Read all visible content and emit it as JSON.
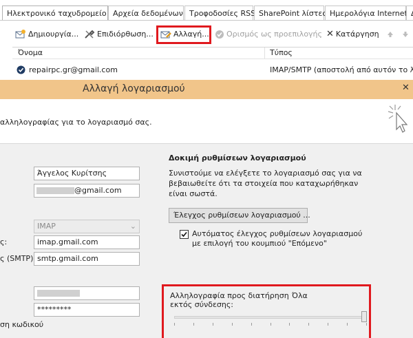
{
  "tabs": [
    {
      "label": "Ηλεκτρονικό ταχυδρομείο",
      "active": true
    },
    {
      "label": "Αρχεία δεδομένων"
    },
    {
      "label": "Τροφοδοσίες RSS"
    },
    {
      "label": "SharePoint λίστες"
    },
    {
      "label": "Ημερολόγια Internet"
    },
    {
      "label": "Δ"
    }
  ],
  "toolbar": {
    "new_label": "Δημιουργία...",
    "repair_label": "Επιδιόρθωση...",
    "change_label": "Αλλαγή...",
    "default_label": "Ορισμός ως προεπιλογής",
    "remove_label": "Κατάργηση"
  },
  "account_list": {
    "col_name": "Όνομα",
    "col_type": "Τύπος",
    "rows": [
      {
        "name": "repairpc.gr@gmail.com",
        "type": "IMAP/SMTP (αποστολή από αυτόν το λογ"
      }
    ]
  },
  "dialog": {
    "title": "Αλλαγή λογαριασμού",
    "close": "✕",
    "subtitle": "αλληλογραφίας για το λογαριασμό σας.",
    "fields": {
      "name_value": "Άγγελος Κυρίτσης",
      "email_suffix": "@gmail.com",
      "account_type": "IMAP",
      "incoming_label": "ς:",
      "incoming_value": "imap.gmail.com",
      "outgoing_label": "ς (SMTP):",
      "outgoing_value": "smtp.gmail.com",
      "password_value": "*********",
      "remember_label": "ση κωδικού"
    },
    "test": {
      "heading": "Δοκιμή ρυθμίσεων λογαριασμού",
      "description": "Συνιστούμε να ελέγξετε το λογαριασμό σας για να βεβαιωθείτε ότι τα στοιχεία που καταχωρήθηκαν είναι σωστά.",
      "button": "Έλεγχος ρυθμίσεων λογαριασμού ...",
      "auto_check_label": "Αυτόματος έλεγχος ρυθμίσεων λογαριασμού με επιλογή του κουμπιού \"Επόμενο\"",
      "auto_check_checked": true
    },
    "offline": {
      "label": "Αλληλογραφία προς διατήρηση εκτός σύνδεσης:",
      "value": "Όλα",
      "slider_fraction": 1.0
    }
  },
  "colors": {
    "highlight_red": "#e0191e",
    "title_bar": "#f1c58a",
    "body_bg": "#f0f0f0"
  }
}
